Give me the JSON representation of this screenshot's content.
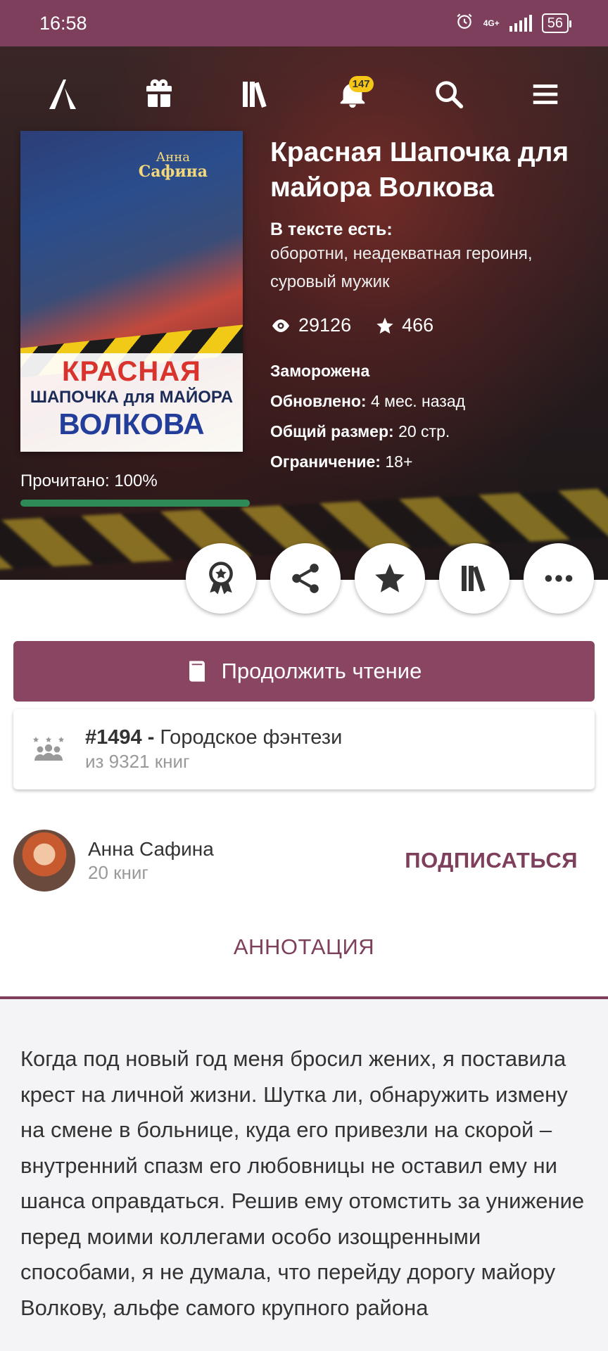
{
  "status_bar": {
    "time": "16:58",
    "network": "4G+",
    "battery": "56"
  },
  "nav": {
    "notifications_count": "147",
    "icons": [
      "logo-icon",
      "gift-icon",
      "library-icon",
      "bell-icon",
      "search-icon",
      "menu-icon"
    ]
  },
  "book": {
    "cover": {
      "author_line1": "Анна",
      "author_line2": "Сафина",
      "title_line1": "КРАСНАЯ",
      "title_line2": "ШАПОЧКА для МАЙОРА",
      "title_line3": "ВОЛКОВА"
    },
    "title": "Красная Шапочка для майора Волкова",
    "tags_label": "В тексте есть:",
    "tags": "оборотни, неадекватная героиня, суровый мужик",
    "views": "29126",
    "stars": "466",
    "status": "Заморожена",
    "updated_label": "Обновлено:",
    "updated_value": "4 мес. назад",
    "size_label": "Общий размер:",
    "size_value": "20 стр.",
    "restriction_label": "Ограничение:",
    "restriction_value": "18+",
    "read_label": "Прочитано: 100%",
    "read_progress": 1.0
  },
  "continue_button": {
    "label": "Продолжить чтение"
  },
  "rank": {
    "position": "#1494 -",
    "genre": "Городское фэнтези",
    "total": "из 9321 книг"
  },
  "author": {
    "name": "Анна Сафина",
    "books": "20 книг",
    "subscribe_label": "ПОДПИСАТЬСЯ"
  },
  "tab": {
    "label": "АННОТАЦИЯ"
  },
  "annotation": {
    "text": "Когда под новый год меня бросил жених, я поставила крест на личной жизни. Шутка ли, обнаружить измену на смене в больнице, куда его привезли на скорой – внутренний спазм его любовницы не оставил ему ни шанса оправдаться. Решив ему отомстить за унижение перед моими коллегами особо изощренными способами, я не думала, что перейду дорогу майору Волкову, альфе самого крупного района"
  },
  "colors": {
    "brand": "#7d3f5c",
    "button": "#8a4563",
    "progress": "#2e8b57",
    "badge": "#f5c518"
  }
}
